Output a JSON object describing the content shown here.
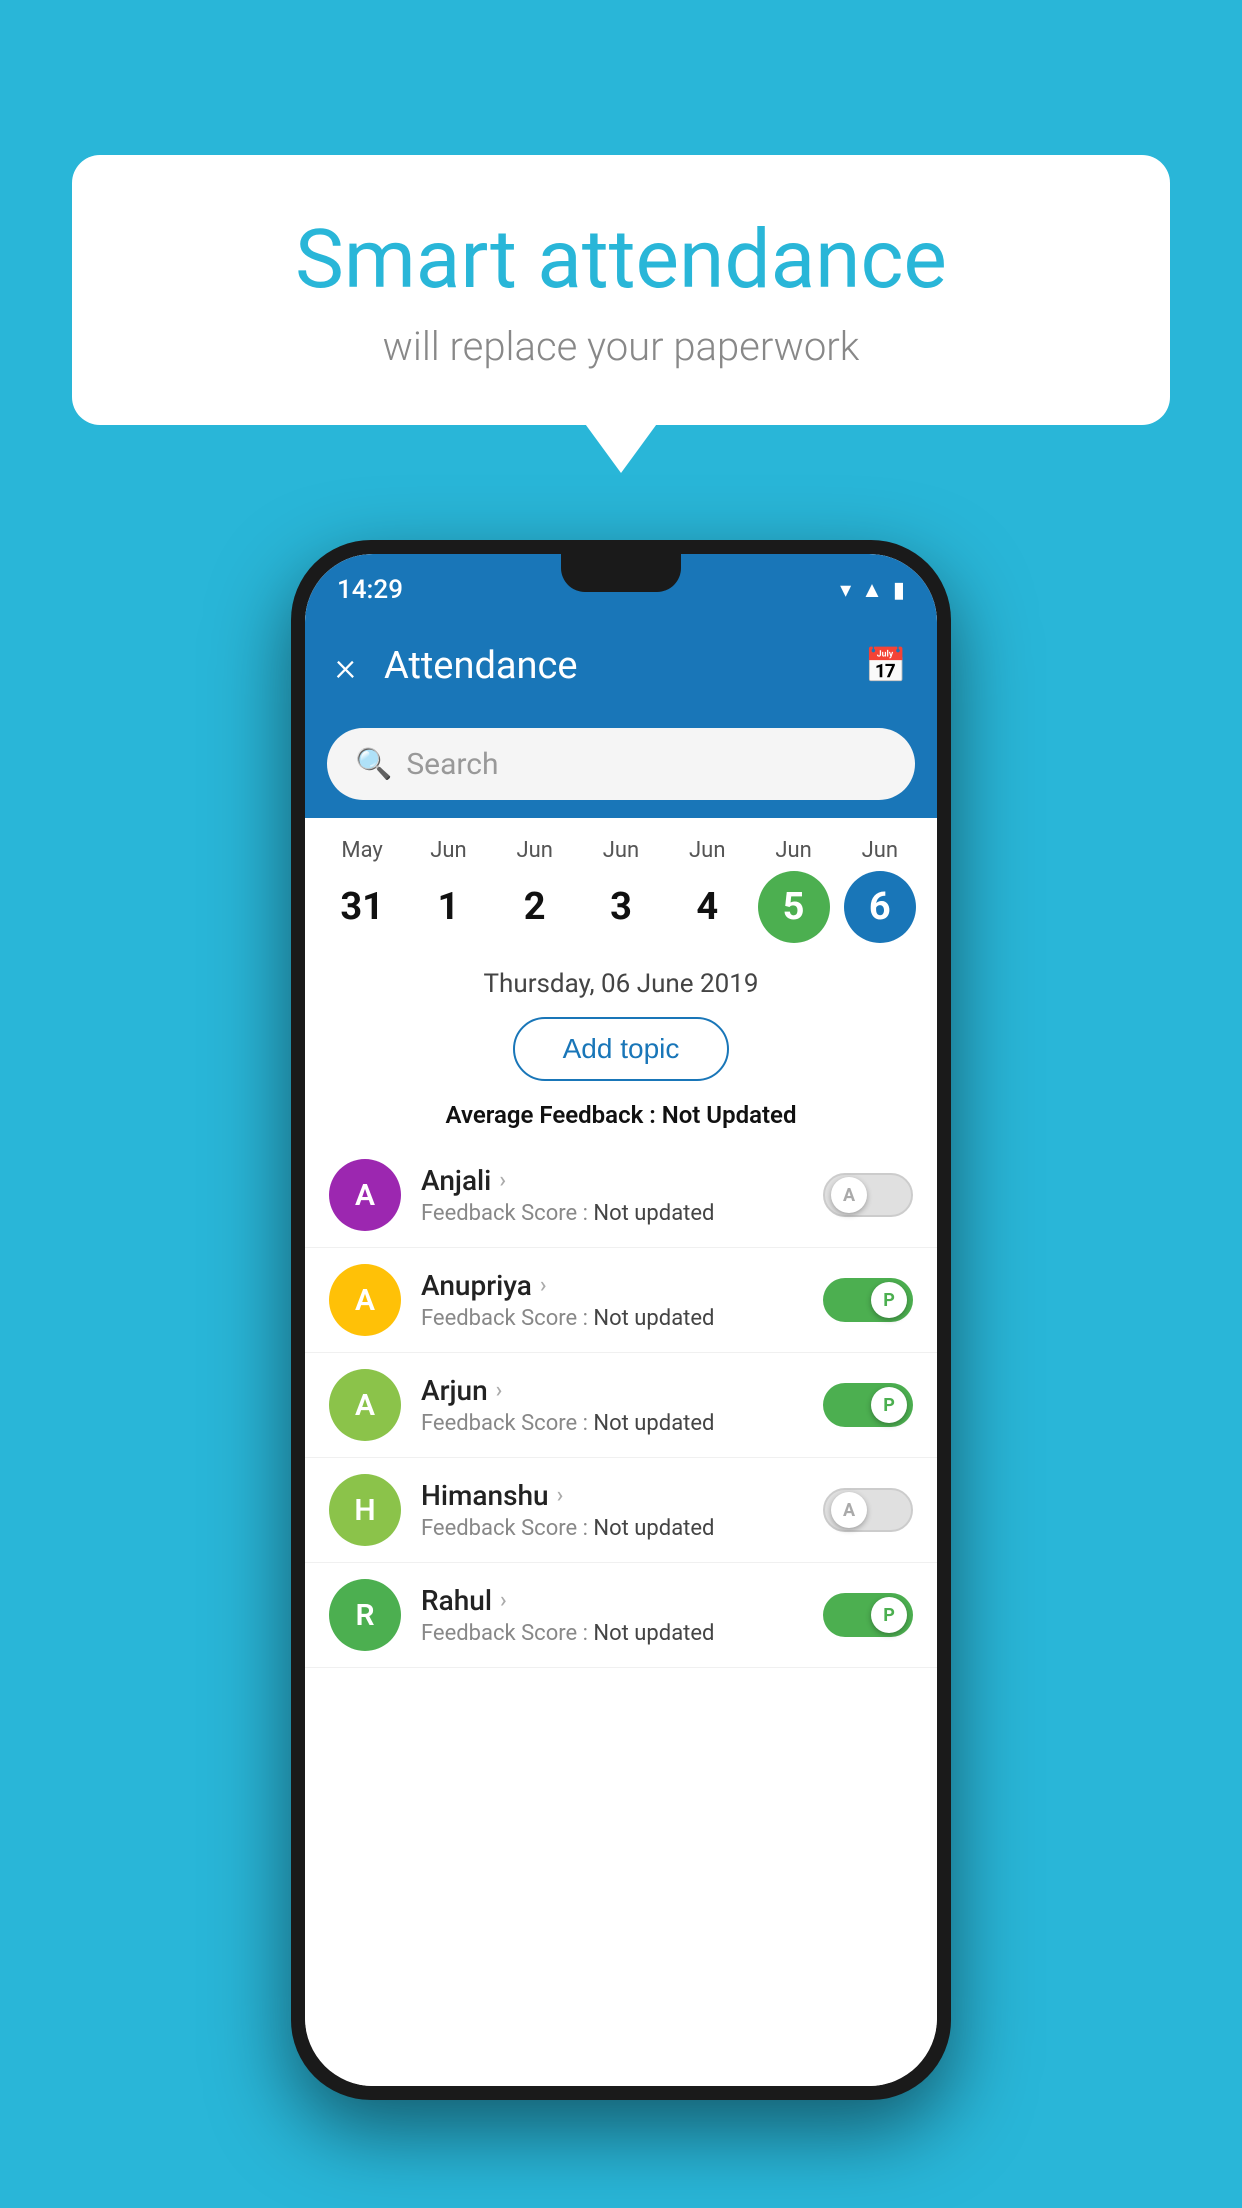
{
  "background_color": "#29B6D8",
  "speech_bubble": {
    "title": "Smart attendance",
    "subtitle": "will replace your paperwork"
  },
  "status_bar": {
    "time": "14:29",
    "icons": [
      "wifi",
      "signal",
      "battery"
    ]
  },
  "app_bar": {
    "title": "Attendance",
    "close_label": "×",
    "calendar_icon": "📅"
  },
  "search": {
    "placeholder": "Search"
  },
  "calendar": {
    "days": [
      {
        "month": "May",
        "date": "31",
        "state": "normal"
      },
      {
        "month": "Jun",
        "date": "1",
        "state": "normal"
      },
      {
        "month": "Jun",
        "date": "2",
        "state": "normal"
      },
      {
        "month": "Jun",
        "date": "3",
        "state": "normal"
      },
      {
        "month": "Jun",
        "date": "4",
        "state": "normal"
      },
      {
        "month": "Jun",
        "date": "5",
        "state": "today"
      },
      {
        "month": "Jun",
        "date": "6",
        "state": "selected"
      }
    ]
  },
  "selected_date": "Thursday, 06 June 2019",
  "add_topic_label": "Add topic",
  "average_feedback": {
    "label": "Average Feedback : ",
    "value": "Not Updated"
  },
  "students": [
    {
      "name": "Anjali",
      "avatar_letter": "A",
      "avatar_color": "#9C27B0",
      "feedback_label": "Feedback Score : ",
      "feedback_value": "Not updated",
      "toggle_state": "off",
      "toggle_label": "A"
    },
    {
      "name": "Anupriya",
      "avatar_letter": "A",
      "avatar_color": "#FFC107",
      "feedback_label": "Feedback Score : ",
      "feedback_value": "Not updated",
      "toggle_state": "on",
      "toggle_label": "P"
    },
    {
      "name": "Arjun",
      "avatar_letter": "A",
      "avatar_color": "#8BC34A",
      "feedback_label": "Feedback Score : ",
      "feedback_value": "Not updated",
      "toggle_state": "on",
      "toggle_label": "P"
    },
    {
      "name": "Himanshu",
      "avatar_letter": "H",
      "avatar_color": "#8BC34A",
      "feedback_label": "Feedback Score : ",
      "feedback_value": "Not updated",
      "toggle_state": "off",
      "toggle_label": "A"
    },
    {
      "name": "Rahul",
      "avatar_letter": "R",
      "avatar_color": "#4CAF50",
      "feedback_label": "Feedback Score : ",
      "feedback_value": "Not updated",
      "toggle_state": "on",
      "toggle_label": "P"
    }
  ]
}
